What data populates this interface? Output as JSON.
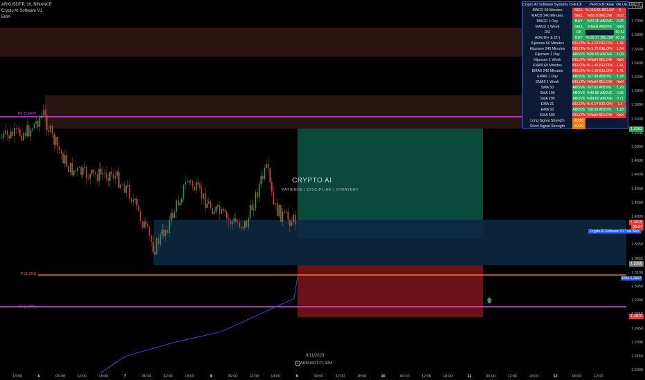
{
  "header": {
    "symbol_line": "ARKUSDT.P, 30, BINANCE",
    "indicator1": "Crypto AI Software V1",
    "indicator2": "EMA"
  },
  "currency_button": "USDT",
  "watermark": {
    "title": "CRYPTO AI",
    "tagline": "PATIENCE | DISCIPLINE | STRATEGY"
  },
  "footer": {
    "date": "9/11/2023",
    "symbol": "ARKUSDT.P | 30M",
    "symbol_glyph": "A"
  },
  "y_axis_ticks": [
    "1.7200",
    "1.7000",
    "1.6800",
    "1.6600",
    "1.6400",
    "1.6200",
    "1.6000",
    "1.5800",
    "1.5600",
    "1.5400",
    "1.5000",
    "1.4800",
    "1.4600",
    "1.4400",
    "1.4200",
    "1.4000",
    "1.3800",
    "1.3650",
    "1.3450",
    "1.3100",
    "1.3050",
    "1.2900",
    "1.2650",
    "1.2450",
    "1.2300",
    "1.2150",
    "1.2000"
  ],
  "x_axis_ticks": [
    {
      "label": "18:00",
      "bold": false
    },
    {
      "label": "6",
      "bold": true
    },
    {
      "label": "06:00",
      "bold": false
    },
    {
      "label": "12:00",
      "bold": false
    },
    {
      "label": "18:00",
      "bold": false
    },
    {
      "label": "7",
      "bold": true
    },
    {
      "label": "06:00",
      "bold": false
    },
    {
      "label": "12:00",
      "bold": false
    },
    {
      "label": "18:00",
      "bold": false
    },
    {
      "label": "8",
      "bold": true
    },
    {
      "label": "06:00",
      "bold": false
    },
    {
      "label": "12:00",
      "bold": false
    },
    {
      "label": "18:00",
      "bold": false
    },
    {
      "label": "9",
      "bold": true
    },
    {
      "label": "06:00",
      "bold": false
    },
    {
      "label": "12:00",
      "bold": false
    },
    {
      "label": "18:00",
      "bold": false
    },
    {
      "label": "10",
      "bold": true
    },
    {
      "label": "06:00",
      "bold": false
    },
    {
      "label": "12:00",
      "bold": false
    },
    {
      "label": "18:00",
      "bold": false
    },
    {
      "label": "11",
      "bold": true
    },
    {
      "label": "06:00",
      "bold": false
    },
    {
      "label": "12:00",
      "bold": false
    },
    {
      "label": "18:00",
      "bold": false
    },
    {
      "label": "12",
      "bold": true
    },
    {
      "label": "06:00",
      "bold": false
    },
    {
      "label": "12:00",
      "bold": false
    }
  ],
  "price_tags": [
    {
      "text": "1.5262",
      "color": "#26a65b"
    },
    {
      "text": "1.3919",
      "color": "#e53935"
    },
    {
      "text": "28:57",
      "color": "#e53935"
    },
    {
      "text": "1.3350",
      "color": "#787b86"
    },
    {
      "text": "1.2870",
      "color": "#e53935"
    }
  ],
  "levels": [
    {
      "label": "R1 (1.547)",
      "color": "#e040fb"
    },
    {
      "label": "P (1.321)",
      "color": "#f57c00"
    },
    {
      "label": "S1 (1.278)",
      "color": "#e040fb"
    }
  ],
  "indicator_label": "Crypto AI Software V1 Trail Stop",
  "ema_tag": "EMA 1.3162",
  "signal_table": {
    "headers": {
      "check": "Crypto AI Software Systems CHECK",
      "status": "",
      "percentage": "PERCENTAGE",
      "value": "VALUE"
    },
    "rows": [
      {
        "check": "MACD 60 Minutes",
        "status": "SELL",
        "pct": "%-115.61 BELOW",
        "val": "0",
        "color": "r"
      },
      {
        "check": "MACD 240 Minutes",
        "status": "SELL",
        "pct": "%68.8 BELOW",
        "val": "0.02",
        "color": "r"
      },
      {
        "check": "MACD 1 Day",
        "status": "BUY",
        "pct": "%22.25 ABOVE",
        "val": "0.25",
        "color": "g"
      },
      {
        "check": "MACD 1 Week",
        "status": "SELL",
        "pct": "%NaN ABOVE",
        "val": "NaN",
        "color": "g"
      },
      {
        "check": "RSI",
        "status": "OK",
        "pct": "",
        "val": "50.52",
        "color": "g"
      },
      {
        "check": "ADX(DI+ & DI-)",
        "status": "BUY",
        "pct": "%-26.27 BELOW",
        "val": "40.59",
        "color": "g"
      },
      {
        "check": "Kijunsen 60 Minutes",
        "status": "BELOW",
        "pct": "%-4.63 BELOW",
        "val": "1.46",
        "color": "r"
      },
      {
        "check": "Kijunsen 240 Minutes",
        "status": "BELOW",
        "pct": "%-9.76 BELOW",
        "val": "1.54",
        "color": "r"
      },
      {
        "check": "Kijunsen 1 Day",
        "status": "ABOVE",
        "pct": "%26.09 ABOVE",
        "val": "1.09",
        "color": "g"
      },
      {
        "check": "Kijunsen 1 Week",
        "status": "BELOW",
        "pct": "%NaN BELOW",
        "val": "NaN",
        "color": "r"
      },
      {
        "check": "EMA9 60 Minutes",
        "status": "BELOW",
        "pct": "%-1.45 BELOW",
        "val": "1.41",
        "color": "r"
      },
      {
        "check": "EMA9 240 Minutes",
        "status": "BELOW",
        "pct": "%-1.39 BELOW",
        "val": "1.41",
        "color": "r"
      },
      {
        "check": "EMA9 1 Day",
        "status": "ABOVE",
        "pct": "%7.99 ABOVE",
        "val": "1.28",
        "color": "g"
      },
      {
        "check": "EMA9 1 Week",
        "status": "BELOW",
        "pct": "%NaN BELOW",
        "val": "NaN",
        "color": "r"
      },
      {
        "check": "SMA 50",
        "status": "ABOVE",
        "pct": "%7.62 ABOVE",
        "val": "1.29",
        "color": "g"
      },
      {
        "check": "SMA 100",
        "status": "ABOVE",
        "pct": "%46.85 ABOVE",
        "val": "0.95",
        "color": "g"
      },
      {
        "check": "SMA 200",
        "status": "ABOVE",
        "pct": "%94.69 ABOVE",
        "val": "0.71",
        "color": "g"
      },
      {
        "check": "EMA 21",
        "status": "BELOW",
        "pct": "%-0.97 BELOW",
        "val": "1.4",
        "color": "r"
      },
      {
        "check": "EMA 50",
        "status": "ABOVE",
        "pct": "%8.09 ABOVE",
        "val": "1.28",
        "color": "g"
      },
      {
        "check": "EMA 500",
        "status": "BELOW",
        "pct": "%NaN BELOW",
        "val": "NaN",
        "color": "r"
      },
      {
        "check": "Long Signal Strength",
        "status": "10/20",
        "pct": "",
        "val": "",
        "color": "o"
      },
      {
        "check": "Short Signal Strength",
        "status": "10/20",
        "pct": "",
        "val": "",
        "color": "o"
      }
    ]
  },
  "colors": {
    "bull": "#26a65b",
    "bear": "#e53935",
    "pivot": "#f57c00",
    "r1s1": "#e040fb",
    "ema": "#2962ff",
    "long_zone": "#0b4a3a",
    "short_zone": "#6b1218",
    "blue_zone": "#0d2a44",
    "supply_zone": "#2a1412"
  }
}
